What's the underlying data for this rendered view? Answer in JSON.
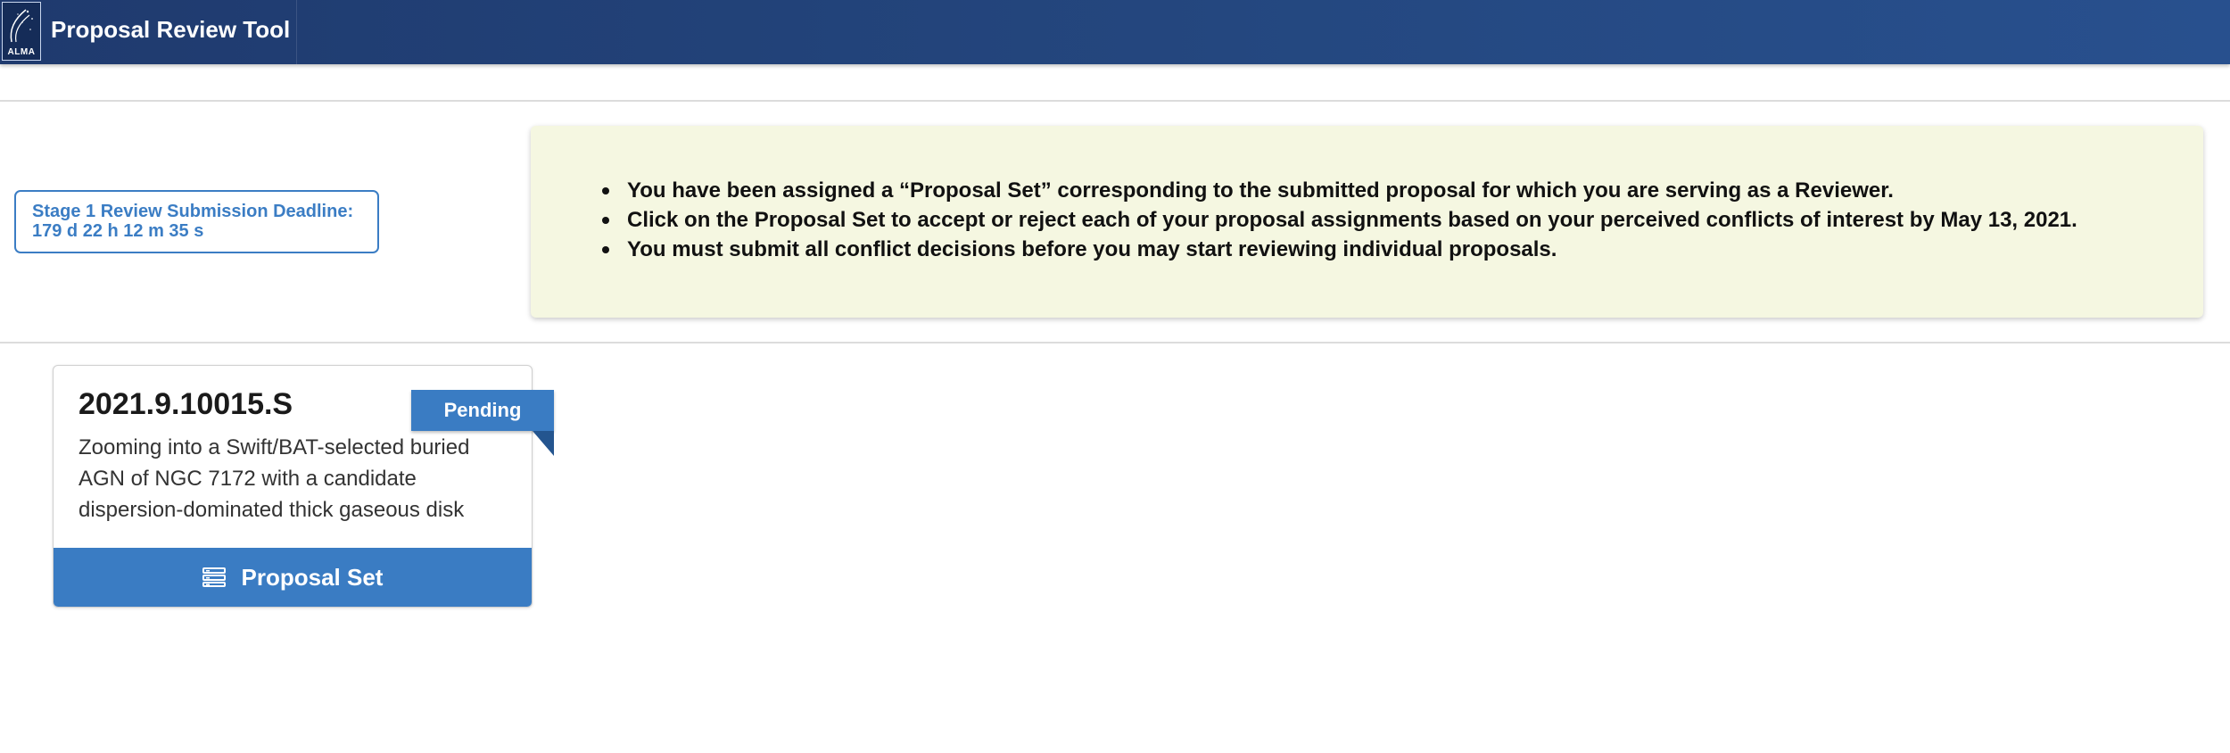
{
  "header": {
    "logo_text": "ALMA",
    "app_title": "Proposal Review Tool"
  },
  "deadline": {
    "label": "Stage 1 Review Submission Deadline:",
    "countdown": "179 d 22 h 12 m 35 s",
    "color": "#3b7dc4"
  },
  "notice": {
    "items": [
      "You have been assigned a “Proposal Set” corresponding to the submitted proposal for which you are serving as a Reviewer.",
      "Click on the Proposal Set to accept or reject each of your proposal assignments based on your perceived conflicts of interest by May 13, 2021.",
      "You must submit all conflict decisions before you may start reviewing individual proposals."
    ],
    "background": "#f5f7e1"
  },
  "card": {
    "proposal_id": "2021.9.10015.S",
    "status": "Pending",
    "description": "Zooming into a Swift/BAT-selected buried AGN of NGC 7172 with a candidate dispersion-dominated thick gaseous disk",
    "button_label": "Proposal Set",
    "button_icon": "list-icon",
    "accent_color": "#3a7cc3"
  }
}
